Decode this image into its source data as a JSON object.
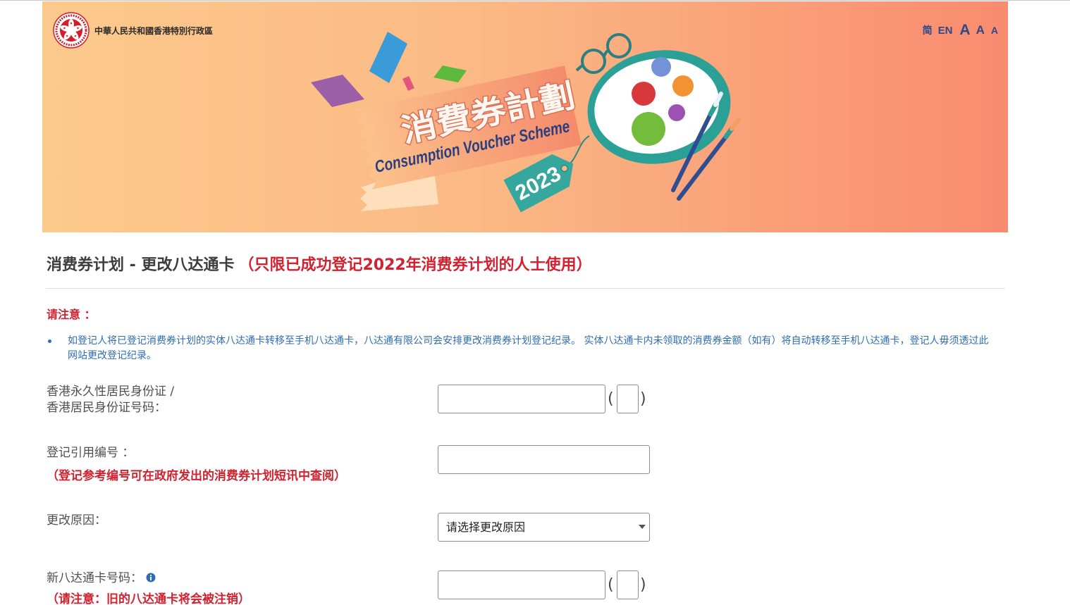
{
  "theme": {
    "accent_red": "#d2212f",
    "link_blue": "#2e6db5",
    "nav_blue": "#2c4b86",
    "banner_gradient": [
      "#fcca8c",
      "#f98b6f"
    ]
  },
  "header": {
    "logo_icon": "hksar-emblem-icon",
    "gov_name": "中華人民共和國香港特別行政區",
    "lang_links": [
      {
        "label": "简"
      },
      {
        "label": "EN"
      }
    ],
    "font_size_controls": [
      {
        "label": "A"
      },
      {
        "label": "A"
      },
      {
        "label": "A"
      }
    ]
  },
  "banner": {
    "title_zh": "消費券計劃",
    "title_en": "Consumption Voucher Scheme",
    "year_tag": "2023"
  },
  "page": {
    "title": "消费券计划 - 更改八达通卡",
    "title_note": "（只限已成功登记2022年消费券计划的人士使用）",
    "notice_heading": "请注意 ：",
    "notice_items": [
      "如登记人将已登记消费券计划的实体八达通卡转移至手机八达通卡，八达通有限公司会安排更改消费券计划登记纪录。 实体八达通卡内未领取的消费券金额（如有）将自动转移至手机八达通卡，登记人毋须透过此网站更改登记纪录。"
    ]
  },
  "form": {
    "hkid": {
      "label_line1": "香港永久性居民身份证 /",
      "label_line2": "香港居民身份证号码：",
      "value": "",
      "check_digit": "",
      "paren_open": "(",
      "paren_close": ")"
    },
    "ref_no": {
      "label": "登记引用编号 ：",
      "note": "（登记参考编号可在政府发出的消费券计划短讯中查阅）",
      "value": ""
    },
    "reason": {
      "label": "更改原因：",
      "selected": "请选择更改原因",
      "arrow_icon": "chevron-down-icon"
    },
    "new_octopus": {
      "label": "新八达通卡号码：",
      "info_icon": "info-icon",
      "note": "（请注意：旧的八达通卡将会被注销）",
      "value": "",
      "check_digit": "",
      "paren_open": "(",
      "paren_close": ")"
    }
  }
}
